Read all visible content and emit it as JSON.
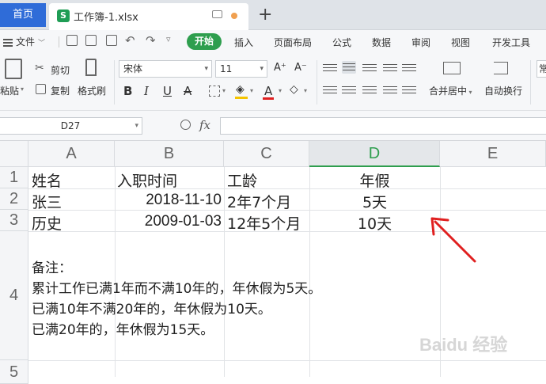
{
  "tabs": {
    "home": "首页",
    "document": "工作簿-1.xlsx"
  },
  "menu": {
    "file": "文件",
    "start": "开始",
    "items": [
      "插入",
      "页面布局",
      "公式",
      "数据",
      "审阅",
      "视图",
      "开发工具"
    ]
  },
  "ribbon": {
    "paste": "粘贴",
    "cut": "剪切",
    "copy": "复制",
    "format_painter": "格式刷",
    "font_name": "宋体",
    "font_size": "11",
    "merge_center": "合并居中",
    "wrap_text": "自动换行",
    "partial_right": "常"
  },
  "formula_bar": {
    "cell_ref": "D27",
    "fx": "fx",
    "value": ""
  },
  "columns": [
    "A",
    "B",
    "C",
    "D",
    "E"
  ],
  "rows": [
    "1",
    "2",
    "3",
    "4",
    "5"
  ],
  "table": {
    "headers": [
      "姓名",
      "入职时间",
      "工龄",
      "年假"
    ],
    "rows": [
      [
        "张三",
        "2018-11-10",
        "2年7个月",
        "5天"
      ],
      [
        "历史",
        "2009-01-03",
        "12年5个月",
        "10天"
      ]
    ]
  },
  "note": {
    "title": "备注：",
    "lines": [
      "累计工作已满1年而不满10年的，年休假为5天。",
      "已满10年不满20年的，年休假为10天。",
      "已满20年的，年休假为15天。"
    ]
  },
  "watermark": "Baidu 经验",
  "colors": {
    "accent_green": "#2e9e4e",
    "home_tab_blue": "#2f6cd8",
    "arrow_red": "#e02020"
  }
}
